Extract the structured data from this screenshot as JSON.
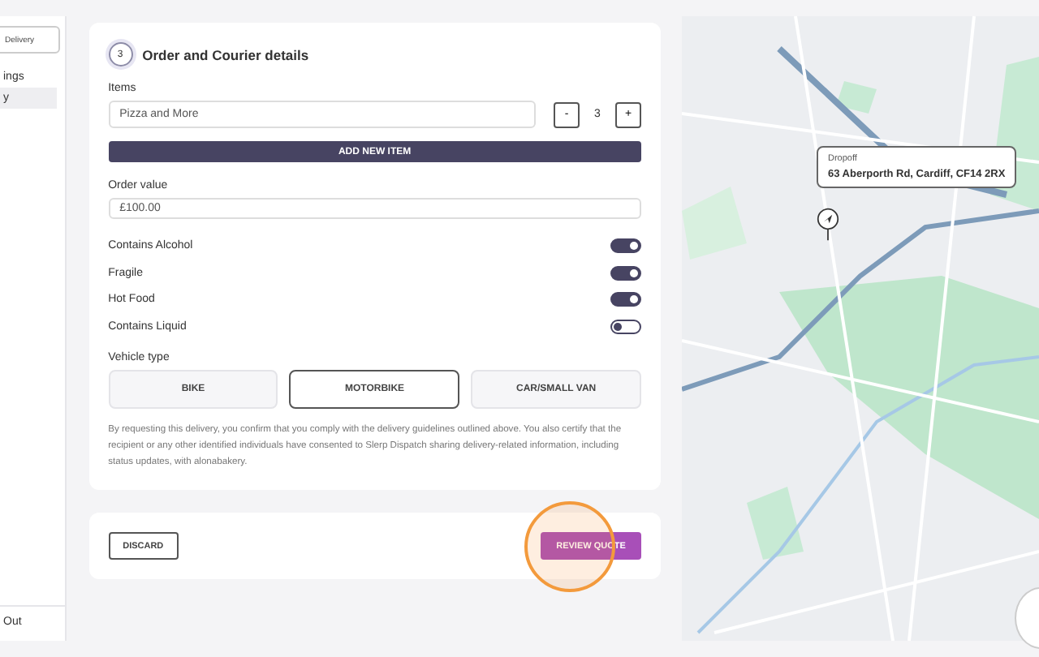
{
  "sidebar": {
    "delivery_button": "Delivery",
    "items": [
      {
        "label": "ings",
        "selected": false
      },
      {
        "label": "y",
        "selected": true
      }
    ],
    "logout": "Out"
  },
  "order_section": {
    "step": "3",
    "title": "Order and Courier details",
    "items_label": "Items",
    "items": [
      {
        "name": "Pizza and More",
        "quantity": "3",
        "decrement": "-",
        "increment": "+"
      }
    ],
    "add_item_button": "ADD NEW ITEM",
    "order_value_label": "Order value",
    "order_value": "£100.00",
    "options": [
      {
        "label": "Contains Alcohol",
        "on": true
      },
      {
        "label": "Fragile",
        "on": true
      },
      {
        "label": "Hot Food",
        "on": true
      },
      {
        "label": "Contains Liquid",
        "on": false
      }
    ],
    "vehicle_label": "Vehicle type",
    "vehicles": [
      {
        "label": "BIKE",
        "selected": false
      },
      {
        "label": "MOTORBIKE",
        "selected": true
      },
      {
        "label": "CAR/SMALL VAN",
        "selected": false
      }
    ],
    "disclaimer": "By requesting this delivery, you confirm that you comply with the delivery guidelines outlined above. You also certify that the recipient or any other identified individuals have consented to Slerp Dispatch sharing delivery-related information, including status updates, with alonabakery."
  },
  "actions": {
    "discard": "DISCARD",
    "review_quote": "REVIEW QUOTE"
  },
  "map": {
    "popup": {
      "label": "Dropoff",
      "address": "63 Aberporth Rd, Cardiff, CF14 2RX"
    }
  }
}
